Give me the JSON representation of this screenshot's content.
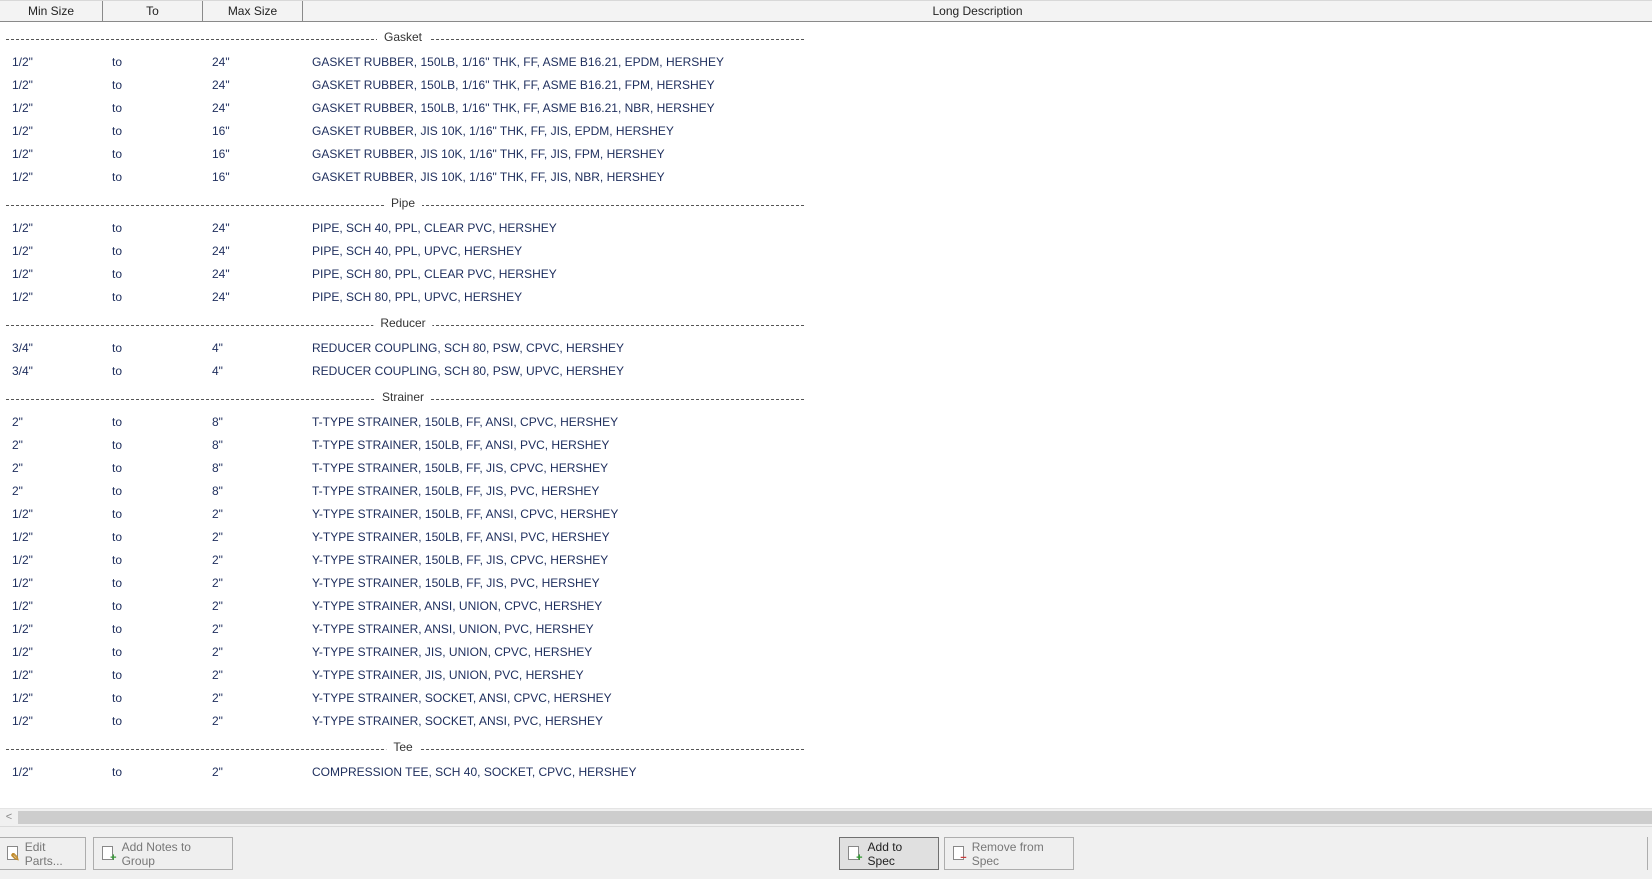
{
  "columns": {
    "min_size": "Min Size",
    "to": "To",
    "max_size": "Max Size",
    "long_description": "Long Description"
  },
  "groups": [
    {
      "name": "Gasket",
      "rows": [
        {
          "min": "1/2\"",
          "to": "to",
          "max": "24\"",
          "desc": "GASKET RUBBER, 150LB, 1/16\" THK, FF, ASME B16.21, EPDM, HERSHEY"
        },
        {
          "min": "1/2\"",
          "to": "to",
          "max": "24\"",
          "desc": "GASKET RUBBER, 150LB, 1/16\" THK, FF, ASME B16.21, FPM, HERSHEY"
        },
        {
          "min": "1/2\"",
          "to": "to",
          "max": "24\"",
          "desc": "GASKET RUBBER, 150LB, 1/16\" THK, FF, ASME B16.21, NBR, HERSHEY"
        },
        {
          "min": "1/2\"",
          "to": "to",
          "max": "16\"",
          "desc": "GASKET RUBBER, JIS 10K, 1/16\" THK, FF, JIS, EPDM, HERSHEY"
        },
        {
          "min": "1/2\"",
          "to": "to",
          "max": "16\"",
          "desc": "GASKET RUBBER, JIS 10K, 1/16\" THK, FF, JIS, FPM, HERSHEY"
        },
        {
          "min": "1/2\"",
          "to": "to",
          "max": "16\"",
          "desc": "GASKET RUBBER, JIS 10K, 1/16\" THK, FF, JIS, NBR, HERSHEY"
        }
      ]
    },
    {
      "name": "Pipe",
      "rows": [
        {
          "min": "1/2\"",
          "to": "to",
          "max": "24\"",
          "desc": "PIPE, SCH 40, PPL, CLEAR PVC, HERSHEY"
        },
        {
          "min": "1/2\"",
          "to": "to",
          "max": "24\"",
          "desc": "PIPE, SCH 40, PPL, UPVC, HERSHEY"
        },
        {
          "min": "1/2\"",
          "to": "to",
          "max": "24\"",
          "desc": "PIPE, SCH 80, PPL, CLEAR PVC, HERSHEY"
        },
        {
          "min": "1/2\"",
          "to": "to",
          "max": "24\"",
          "desc": "PIPE, SCH 80, PPL, UPVC, HERSHEY"
        }
      ]
    },
    {
      "name": "Reducer",
      "rows": [
        {
          "min": "3/4\"",
          "to": "to",
          "max": "4\"",
          "desc": "REDUCER COUPLING, SCH 80, PSW, CPVC, HERSHEY"
        },
        {
          "min": "3/4\"",
          "to": "to",
          "max": "4\"",
          "desc": "REDUCER COUPLING, SCH 80, PSW, UPVC, HERSHEY"
        }
      ]
    },
    {
      "name": "Strainer",
      "rows": [
        {
          "min": "2\"",
          "to": "to",
          "max": "8\"",
          "desc": "T-TYPE STRAINER, 150LB, FF, ANSI, CPVC, HERSHEY"
        },
        {
          "min": "2\"",
          "to": "to",
          "max": "8\"",
          "desc": "T-TYPE STRAINER, 150LB, FF, ANSI, PVC, HERSHEY"
        },
        {
          "min": "2\"",
          "to": "to",
          "max": "8\"",
          "desc": "T-TYPE STRAINER, 150LB, FF, JIS, CPVC, HERSHEY"
        },
        {
          "min": "2\"",
          "to": "to",
          "max": "8\"",
          "desc": "T-TYPE STRAINER, 150LB, FF, JIS, PVC, HERSHEY"
        },
        {
          "min": "1/2\"",
          "to": "to",
          "max": "2\"",
          "desc": "Y-TYPE STRAINER, 150LB, FF, ANSI, CPVC, HERSHEY"
        },
        {
          "min": "1/2\"",
          "to": "to",
          "max": "2\"",
          "desc": "Y-TYPE STRAINER, 150LB, FF, ANSI, PVC, HERSHEY"
        },
        {
          "min": "1/2\"",
          "to": "to",
          "max": "2\"",
          "desc": "Y-TYPE STRAINER, 150LB, FF, JIS, CPVC, HERSHEY"
        },
        {
          "min": "1/2\"",
          "to": "to",
          "max": "2\"",
          "desc": "Y-TYPE STRAINER, 150LB, FF, JIS, PVC, HERSHEY"
        },
        {
          "min": "1/2\"",
          "to": "to",
          "max": "2\"",
          "desc": "Y-TYPE STRAINER, ANSI, UNION, CPVC, HERSHEY"
        },
        {
          "min": "1/2\"",
          "to": "to",
          "max": "2\"",
          "desc": "Y-TYPE STRAINER, ANSI, UNION, PVC, HERSHEY"
        },
        {
          "min": "1/2\"",
          "to": "to",
          "max": "2\"",
          "desc": "Y-TYPE STRAINER, JIS, UNION, CPVC, HERSHEY"
        },
        {
          "min": "1/2\"",
          "to": "to",
          "max": "2\"",
          "desc": "Y-TYPE STRAINER, JIS, UNION, PVC, HERSHEY"
        },
        {
          "min": "1/2\"",
          "to": "to",
          "max": "2\"",
          "desc": "Y-TYPE STRAINER, SOCKET, ANSI, CPVC, HERSHEY"
        },
        {
          "min": "1/2\"",
          "to": "to",
          "max": "2\"",
          "desc": "Y-TYPE STRAINER, SOCKET, ANSI, PVC, HERSHEY"
        }
      ]
    },
    {
      "name": "Tee",
      "rows": [
        {
          "min": "1/2\"",
          "to": "to",
          "max": "2\"",
          "desc": "COMPRESSION TEE, SCH 40, SOCKET, CPVC, HERSHEY"
        }
      ]
    }
  ],
  "toolbar": {
    "edit_parts": "Edit Parts...",
    "add_notes": "Add Notes to Group",
    "add_to_spec": "Add to Spec",
    "remove_from_spec": "Remove from Spec"
  },
  "scroll_arrow": "<"
}
